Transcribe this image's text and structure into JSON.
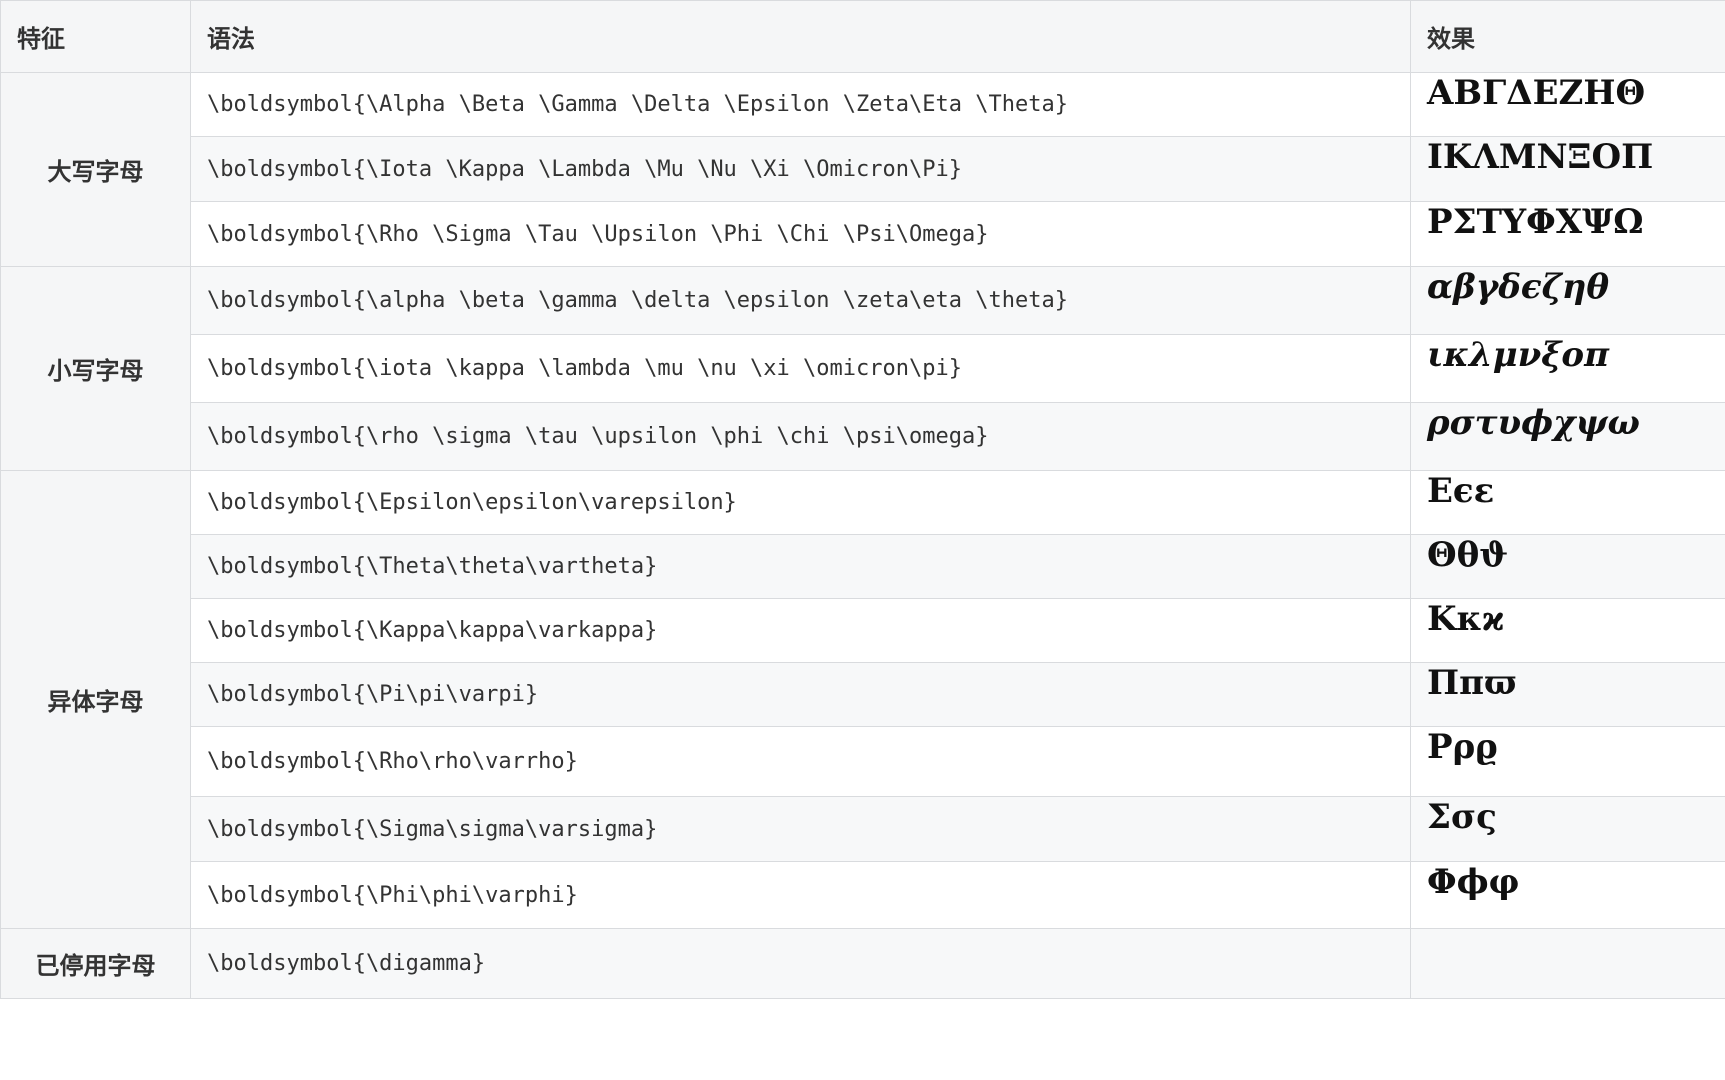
{
  "header": {
    "col_feature": "特征",
    "col_syntax": "语法",
    "col_effect": "效果"
  },
  "groups": {
    "uppercase": "大写字母",
    "lowercase": "小写字母",
    "variants": "异体字母",
    "deprecated": "已停用字母"
  },
  "rows": [
    {
      "syntax": "\\boldsymbol{\\Alpha \\Beta \\Gamma \\Delta \\Epsilon \\Zeta\\Eta \\Theta}",
      "effect": "ΑΒΓΔΕΖΗΘ"
    },
    {
      "syntax": "\\boldsymbol{\\Iota \\Kappa \\Lambda \\Mu \\Nu \\Xi \\Omicron\\Pi}",
      "effect": "ΙΚΛΜΝΞΟΠ"
    },
    {
      "syntax": "\\boldsymbol{\\Rho \\Sigma \\Tau \\Upsilon \\Phi \\Chi \\Psi\\Omega}",
      "effect": "ΡΣΤΥΦΧΨΩ"
    },
    {
      "syntax": "\\boldsymbol{\\alpha \\beta \\gamma \\delta \\epsilon \\zeta\\eta \\theta}",
      "effect": "αβγδϵζηθ"
    },
    {
      "syntax": "\\boldsymbol{\\iota \\kappa \\lambda \\mu \\nu \\xi \\omicron\\pi}",
      "effect": "ικλμνξοπ"
    },
    {
      "syntax": "\\boldsymbol{\\rho \\sigma \\tau \\upsilon \\phi \\chi \\psi\\omega}",
      "effect": "ρστυϕχψω"
    },
    {
      "syntax": "\\boldsymbol{\\Epsilon\\epsilon\\varepsilon}",
      "effect": "Εϵε"
    },
    {
      "syntax": "\\boldsymbol{\\Theta\\theta\\vartheta}",
      "effect": "Θθϑ"
    },
    {
      "syntax": "\\boldsymbol{\\Kappa\\kappa\\varkappa}",
      "effect": "Κκϰ"
    },
    {
      "syntax": "\\boldsymbol{\\Pi\\pi\\varpi}",
      "effect": "Ππϖ"
    },
    {
      "syntax": "\\boldsymbol{\\Rho\\rho\\varrho}",
      "effect": "Ρρϱ"
    },
    {
      "syntax": "\\boldsymbol{\\Sigma\\sigma\\varsigma}",
      "effect": "Σσς"
    },
    {
      "syntax": "\\boldsymbol{\\Phi\\phi\\varphi}",
      "effect": "Φϕφ"
    },
    {
      "syntax": "\\boldsymbol{\\digamma}",
      "effect": ""
    }
  ]
}
